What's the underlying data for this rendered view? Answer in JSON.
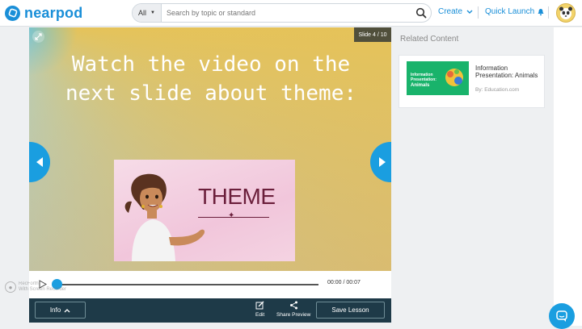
{
  "brand": {
    "name": "nearpod",
    "color": "#1a8fd8"
  },
  "search": {
    "category": "All",
    "placeholder": "Search by topic or standard"
  },
  "nav": {
    "create_label": "Create",
    "quick_launch_label": "Quick Launch"
  },
  "slide": {
    "counter": "Slide 4 / 10",
    "text": "Watch the video on the next slide about theme:",
    "image_word": "THEME"
  },
  "player": {
    "time": "00:00 / 00:07"
  },
  "watermark": {
    "line1": "RecForth",
    "line2": "With Screen Recorder"
  },
  "bottombar": {
    "info_label": "Info",
    "edit_label": "Edit",
    "share_label": "Share Preview",
    "save_label": "Save Lesson"
  },
  "sidebar": {
    "heading": "Related Content",
    "cards": [
      {
        "thumb_line1": "Information",
        "thumb_line2": "Presentation:",
        "thumb_line3": "Animals",
        "title": "Information Presentation: Animals",
        "author": "By: Education.com"
      }
    ]
  },
  "colors": {
    "accent": "#1a9ee0",
    "bar": "#1e3a48"
  }
}
